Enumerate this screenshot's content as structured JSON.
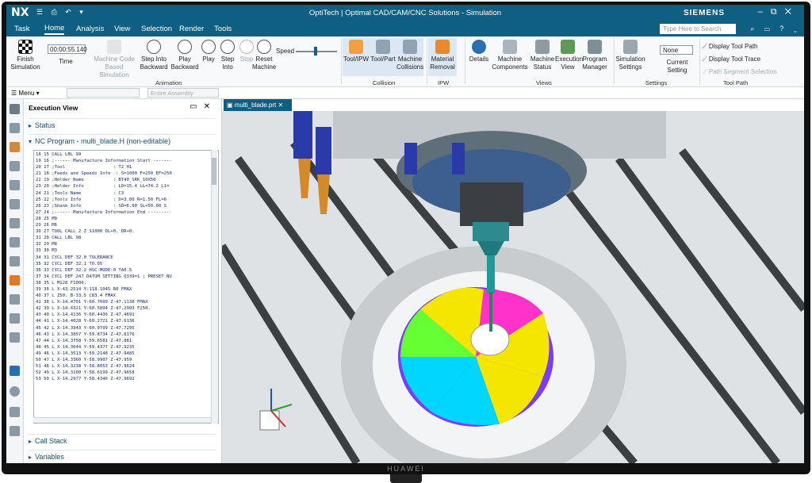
{
  "window": {
    "app_logo": "NX",
    "title": "OptiTech | Optimal CAD/CAM/CNC Solutions - Simulation",
    "vendor": "SIEMENS",
    "controls": [
      "minimize-icon",
      "restore-icon",
      "close-icon"
    ]
  },
  "menu_tabs": [
    "Task",
    "Home",
    "Analysis",
    "View",
    "Selection",
    "Render",
    "Tools"
  ],
  "active_tab": "Home",
  "search": {
    "placeholder": "Type Here to Search"
  },
  "ribbon": {
    "finish_simulation": "Finish Simulation",
    "time_value": "00:00:55.140",
    "time_label": "Time",
    "machine_code_based": "Machine Code Based Simulation",
    "step_into_backward": "Step Into Backward",
    "play_backward": "Play Backward",
    "play": "Play",
    "step_into": "Step Into",
    "stop": "Stop",
    "reset_machine": "Reset Machine",
    "speed_label": "Speed",
    "animation_group": "Animation",
    "tool_ipw": "Tool/IPW",
    "tool_part": "Tool/Part",
    "machine_collisions": "Machine Collisions",
    "collision_group": "Collision",
    "material_removal": "Material Removal",
    "ipw_group": "IPW",
    "details": "Details",
    "machine_components": "Machine Components",
    "machine_status": "Machine Status",
    "execution_view": "Execution View",
    "program_manager": "Program Manager",
    "views_group": "Views",
    "simulation_settings": "Simulation Settings",
    "none_value": "None",
    "current_setting": "Current Setting",
    "settings_group": "Settings",
    "display_tool_path": "Display Tool Path",
    "display_tool_trace": "Display Tool Trace",
    "path_segment_selection": "Path Segment Selection",
    "tool_path_group": "Tool Path"
  },
  "menubar": {
    "menu": "Menu",
    "assembly_filter": "Entire Assembly"
  },
  "panel": {
    "title": "Execution View",
    "status": "Status",
    "nc_program": "NC Program - multi_blade.H (non-editable)",
    "call_stack": "Call Stack",
    "variables": "Variables"
  },
  "code_lines": [
    "18 15 CALL LBL 99",
    "19 16 ;------ Manufacture Information Start -------",
    "20 17 ;Tool                  : T2 H1",
    "21 18 ;Feeds and Speeds Info  : S=1000 F=250 EF=250",
    "22 19 ;Holder Name           : BT40_SRK_10X50",
    "23 20 ;Holder Info           : LD=15.4 LL=74.2 L1=",
    "24 21 ;Tools Name            : C3",
    "25 22 ;Tools Info            : D=3.00 R=1.50 FL=6",
    "26 23 ;Shank Info            : SD=6.00 SL=50.00 S",
    "27 24 ;------ Manufacture Information End ---------",
    "28 25 M0",
    "29 26 M6",
    "30 27 TOOL CALL 2 Z S1000 DL+0. DR+0.",
    "31 28 CALL LBL 98",
    "32 29 M8",
    "33 30 M3",
    "34 31 CYCL DEF 32.0 TOLERANCE",
    "35 32 CYCL DEF 32.1 T0.05",
    "36 33 CYCL DEF 32.2 HSC-MODE:0 TA0.5",
    "37 34 CYCL DEF 247 DATUM SETTING Q339=1 ; PRESET NU",
    "38 35 L M128 F1000.",
    "39 36 L X-43.2514 Y-118.1045 R0 FMAX",
    "40 37 L Z50. B-33.5 C83.4 FMAX",
    "41 38 L X-14.4701 Y-60.7099 Z-47.1138 FMAX",
    "42 39 L X-14.4321 Y-60.5894 Z-47.2993 F250.",
    "43 40 L X-14.4136 Y-60.4436 Z-47.4691",
    "44 41 L X-14.4028 Y-60.2721 Z-47.6136",
    "45 42 L X-14.3943 Y-60.0799 Z-47.7295",
    "46 43 L X-14.3857 Y-59.8734 Z-47.8176",
    "47 44 L X-14.3758 Y-59.6581 Z-47.881",
    "48 45 L X-14.3644 Y-59.4377 Z-47.9235",
    "49 46 L X-14.3513 Y-59.2148 Z-47.9485",
    "50 47 L X-14.3360 Y-58.9907 Z-47.959",
    "51 48 L X-14.3238 Y-58.8053 Z-47.9624",
    "52 49 L X-14.3100 Y-58.6199 Z-47.9658",
    "53 50 L X-14.2977 Y-58.4346 Z-47.9692"
  ],
  "doc_tab": "multi_blade.prt",
  "monitor_brand": "HUAWEI",
  "colors": {
    "titlebar": "#0f5f83",
    "code_text": "#1a2a6a",
    "blade_colors": [
      "#f5e600",
      "#ff33cc",
      "#00d6ff",
      "#66ff33",
      "#b000ff"
    ]
  }
}
